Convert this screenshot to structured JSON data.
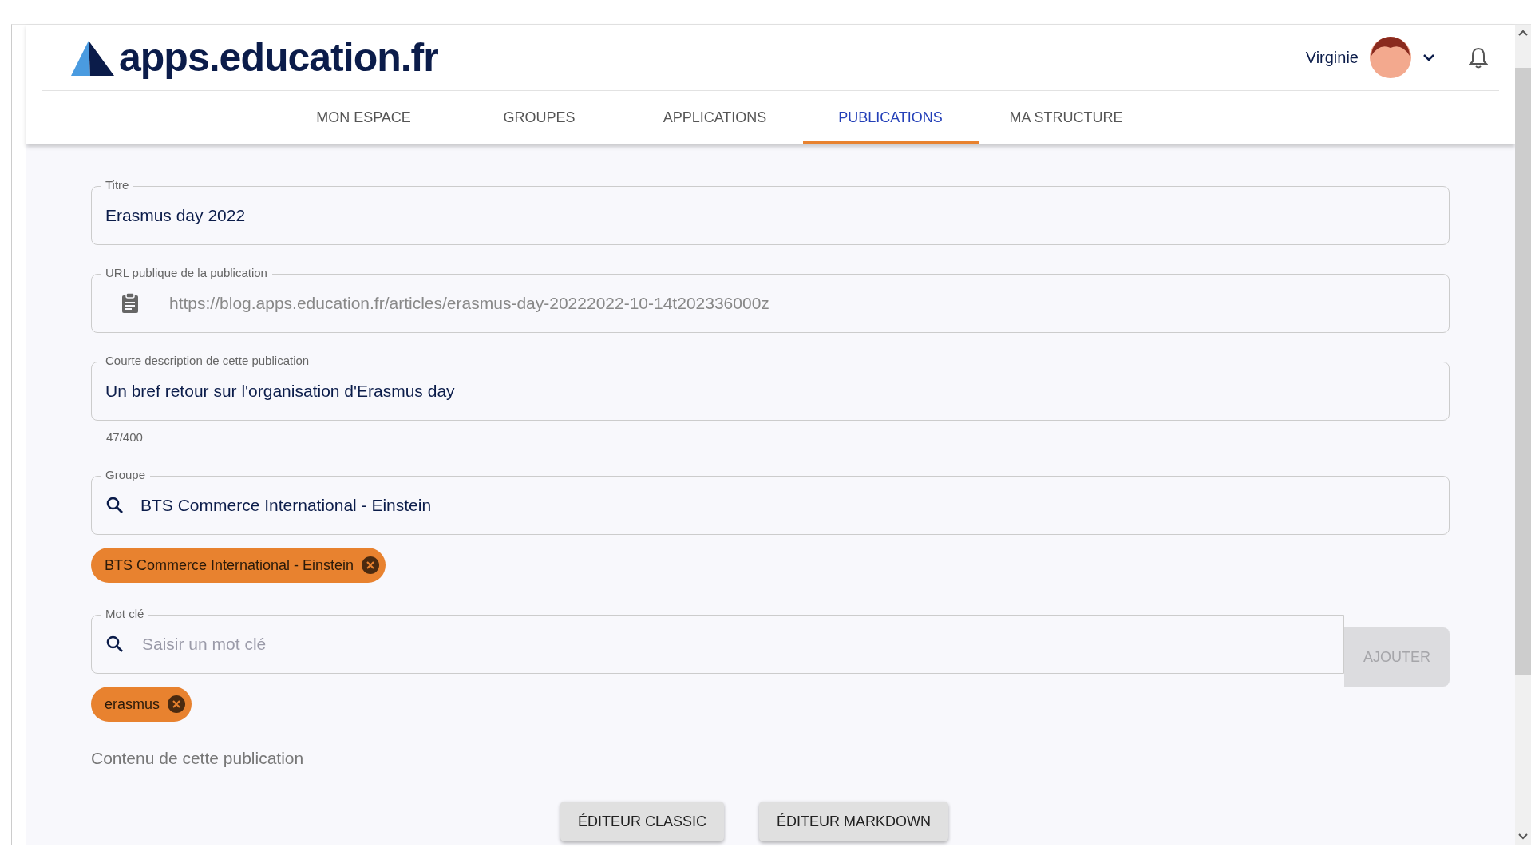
{
  "header": {
    "logo": "apps.education.fr",
    "user": {
      "name": "Virginie"
    }
  },
  "nav": [
    {
      "label": "MON ESPACE",
      "selected": false
    },
    {
      "label": "GROUPES",
      "selected": false
    },
    {
      "label": "APPLICATIONS",
      "selected": false
    },
    {
      "label": "PUBLICATIONS",
      "selected": true
    },
    {
      "label": "MA STRUCTURE",
      "selected": false
    }
  ],
  "form": {
    "title": {
      "label": "Titre",
      "value": "Erasmus day 2022"
    },
    "url": {
      "label": "URL publique de la publication",
      "value": "https://blog.apps.education.fr/articles/erasmus-day-20222022-10-14t202336000z"
    },
    "description": {
      "label": "Courte description de cette publication",
      "value": "Un bref retour sur l'organisation d'Erasmus day",
      "counter": "47/400"
    },
    "group": {
      "label": "Groupe",
      "value": "BTS Commerce International - Einstein",
      "chips": [
        "BTS Commerce International - Einstein"
      ]
    },
    "keyword": {
      "label": "Mot clé",
      "placeholder": "Saisir un mot clé",
      "button": {
        "label": "AJOUTER",
        "disabled": true
      },
      "chips": [
        "erasmus"
      ]
    },
    "content_label": "Contenu de cette publication",
    "editor_buttons": [
      "ÉDITEUR CLASSIC",
      "ÉDITEUR MARKDOWN"
    ]
  }
}
